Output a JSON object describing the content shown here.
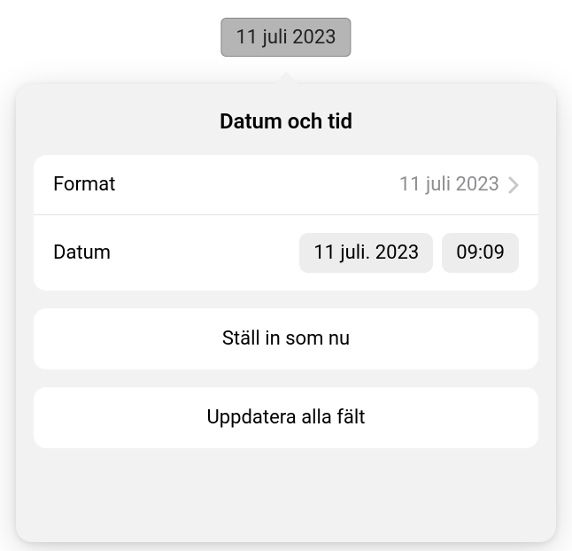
{
  "chip": {
    "text": "11 juli 2023"
  },
  "sheet": {
    "title": "Datum och tid",
    "format": {
      "label": "Format",
      "value": "11 juli 2023"
    },
    "date": {
      "label": "Datum",
      "date_value": "11 juli. 2023",
      "time_value": "09:09"
    },
    "set_now_button": "Ställ in som nu",
    "update_all_button": "Uppdatera alla fält"
  }
}
